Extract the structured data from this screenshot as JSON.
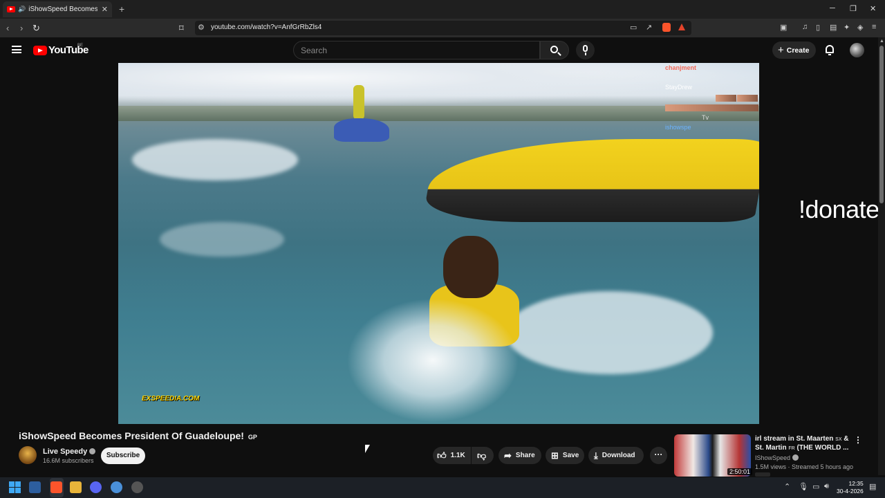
{
  "browser": {
    "tab_title": "iShowSpeed Becomes Preside",
    "tab_close": "✕",
    "new_tab": "+",
    "url": "youtube.com/watch?v=AnfGrRbZls4",
    "window_controls": [
      "─",
      "❐",
      "✕"
    ]
  },
  "youtube": {
    "logo_text": "YouTube",
    "country_code": "BE",
    "search_placeholder": "Search",
    "create_label": "Create",
    "create_plus": "+"
  },
  "video": {
    "overlay_chat": [
      "chanjment",
      "StayDrew",
      "Tv",
      "ishowspe"
    ],
    "watermark": "EXSPEEDIA.COM"
  },
  "side_overlay_text": "!donate",
  "info": {
    "title": "iShowSpeed Becomes President Of Guadeloupe!",
    "title_flag": "GP",
    "channel_name": "Live Speedy",
    "subscribers": "16.6M subscribers",
    "subscribe_label": "Subscribe",
    "like_count": "1.1K",
    "share_label": "Share",
    "save_label": "Save",
    "download_label": "Download",
    "more_label": "···"
  },
  "recommended": {
    "title_part1": "irl stream in St. Maarten",
    "title_cc1": "SX",
    "title_part2": "& St. Martin",
    "title_cc2": "FR",
    "title_part3": "(THE WORLD ...",
    "channel": "IShowSpeed",
    "meta": "1.5M views · Streamed 5 hours ago",
    "duration": "2:50:01",
    "kebab": "⋮"
  },
  "taskbar": {
    "time": "12:35",
    "date": "30-4-2026"
  },
  "colors": {
    "youtube_red": "#ff0000",
    "background": "#0f0f0f",
    "pill": "#272727"
  }
}
